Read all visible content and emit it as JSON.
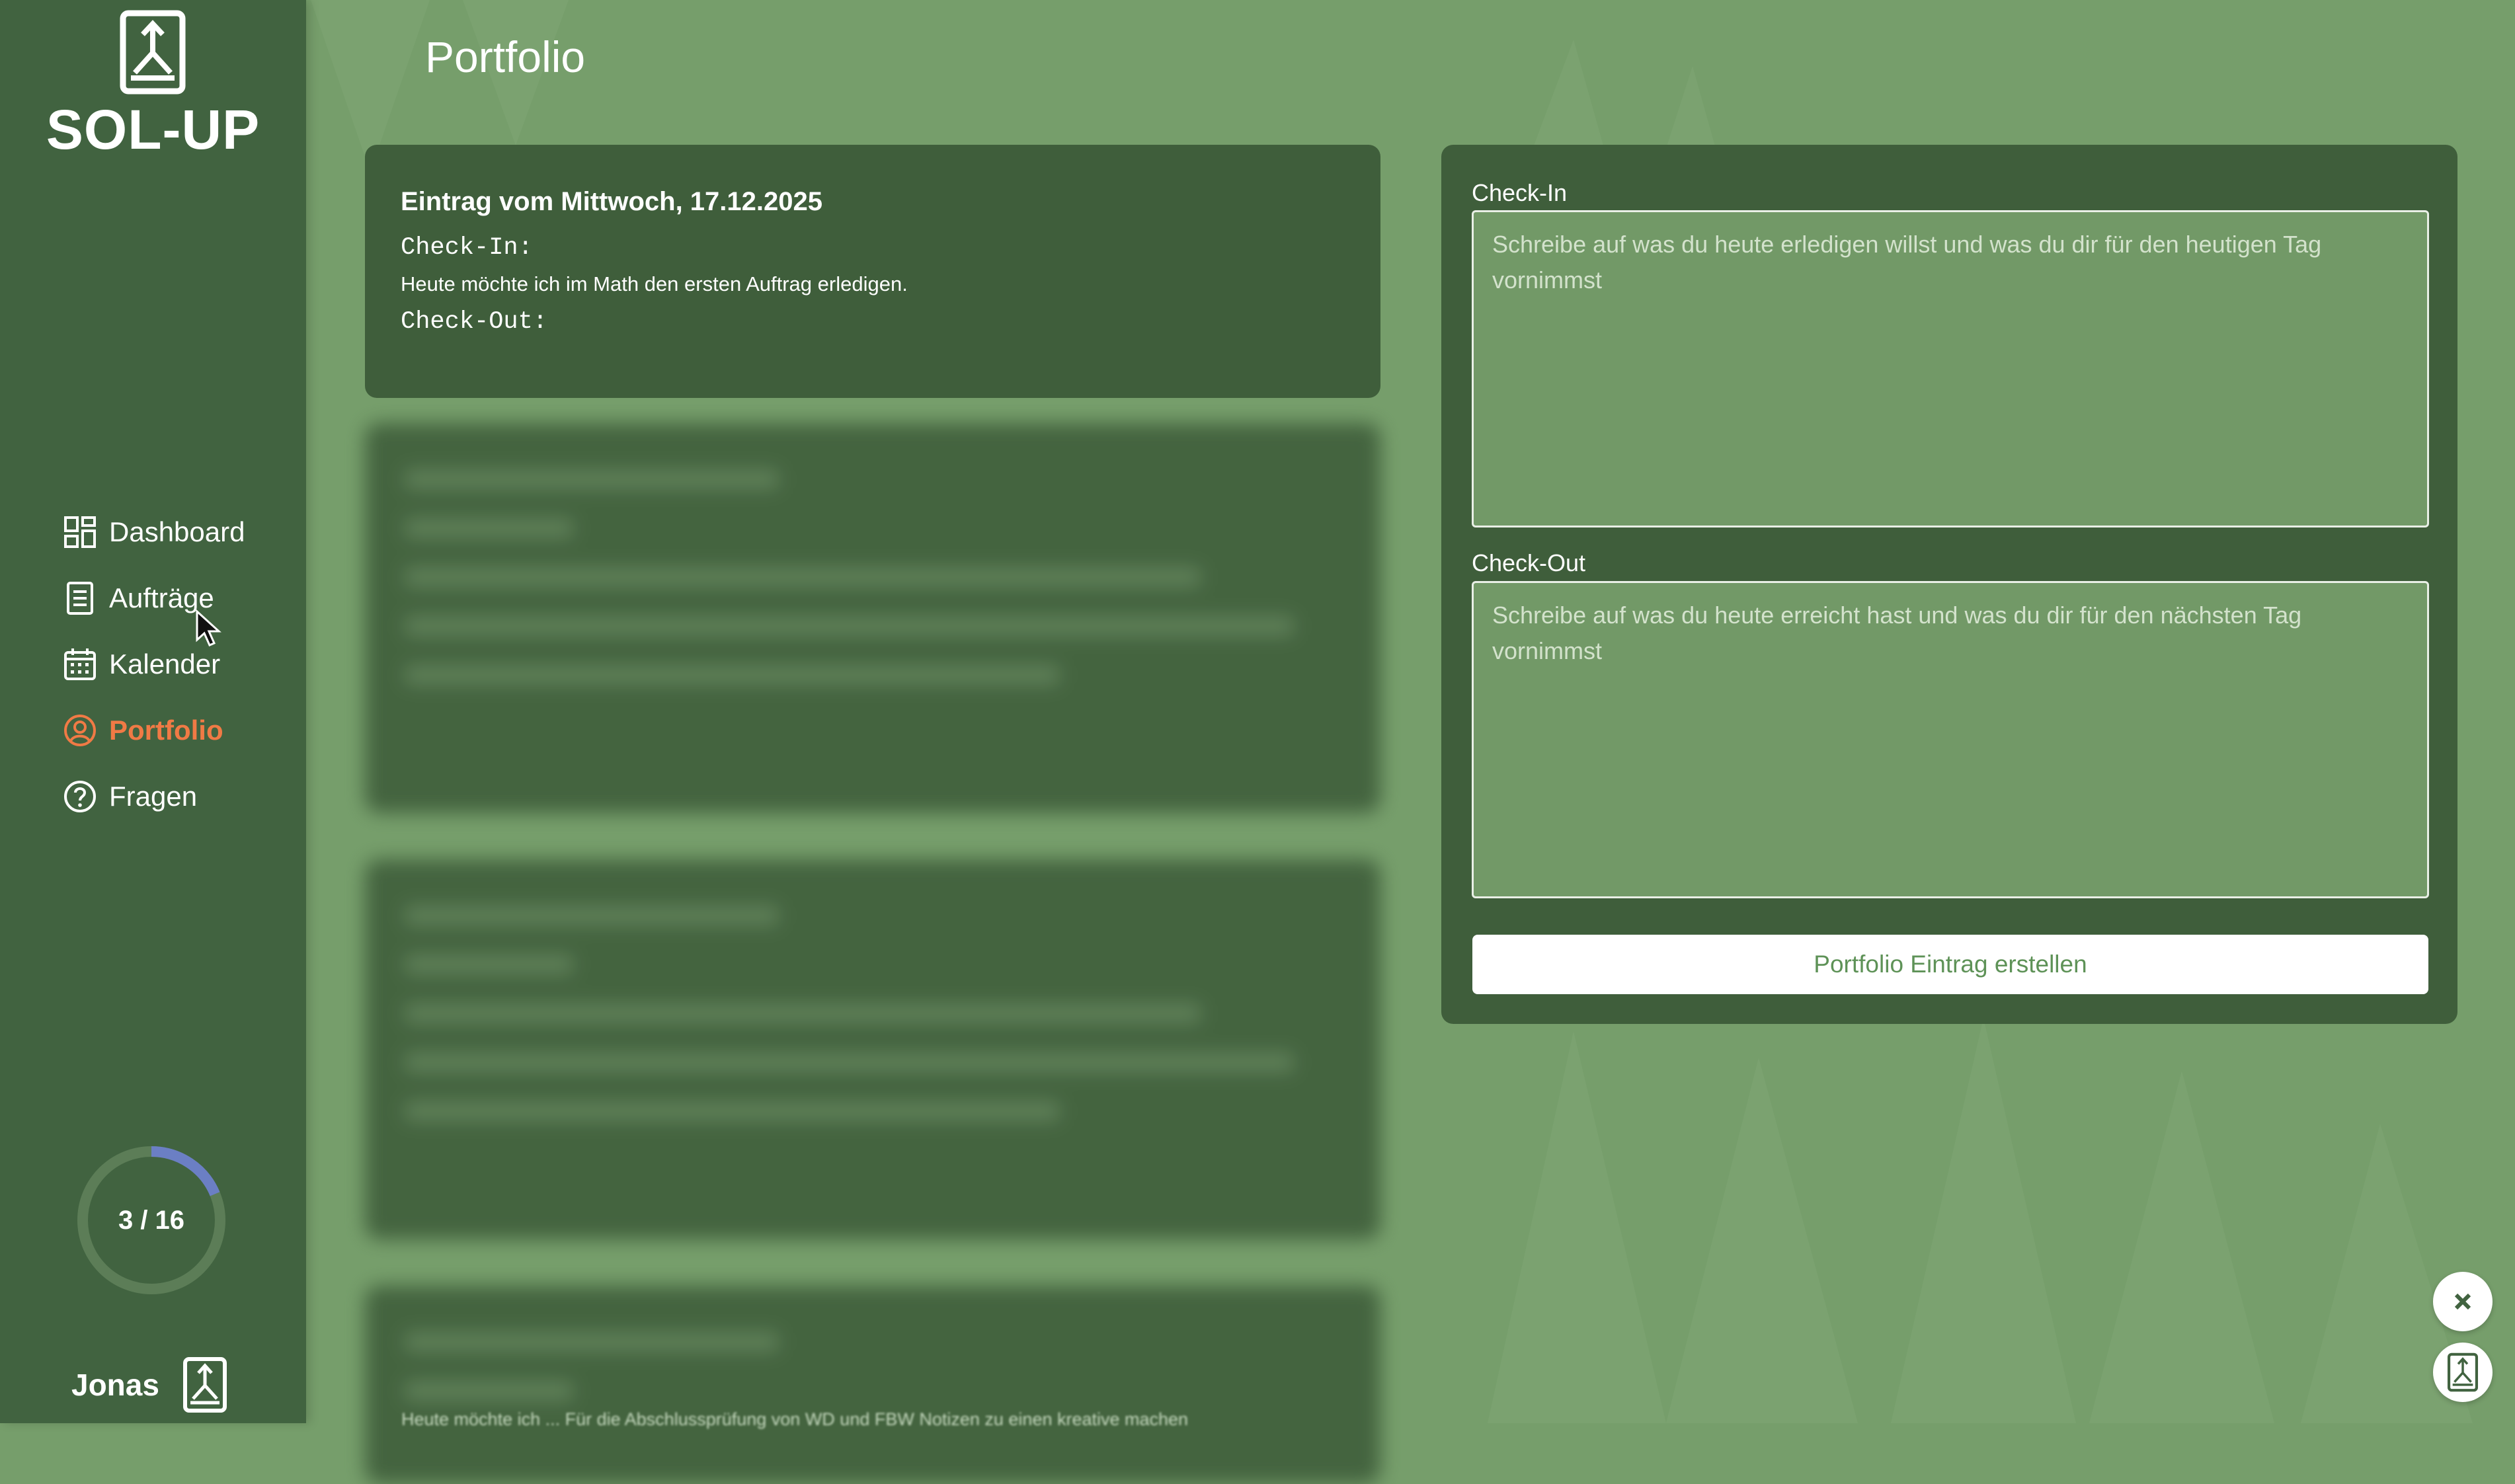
{
  "app": {
    "name": "SOL-UP"
  },
  "colors": {
    "sidebar": "#416340",
    "background": "#769e6b",
    "accent": "#f07a45",
    "card": "#3f5e3b",
    "progress": "#6b7fc4"
  },
  "sidebar": {
    "items": [
      {
        "label": "Dashboard",
        "icon": "dashboard-icon",
        "active": false
      },
      {
        "label": "Aufträge",
        "icon": "document-icon",
        "active": false
      },
      {
        "label": "Kalender",
        "icon": "calendar-icon",
        "active": false
      },
      {
        "label": "Portfolio",
        "icon": "user-circle-icon",
        "active": true
      },
      {
        "label": "Fragen",
        "icon": "question-icon",
        "active": false
      }
    ],
    "progress": {
      "text": "3 / 16",
      "done": 3,
      "total": 16
    },
    "user": {
      "name": "Jonas"
    }
  },
  "main": {
    "title": "Portfolio",
    "entry": {
      "title": "Eintrag vom Mittwoch, 17.12.2025",
      "checkin_label": "Check-In:",
      "checkin_text": "Heute möchte ich im Math den ersten Auftrag erledigen.",
      "checkout_label": "Check-Out:"
    },
    "blurred_footer": "Heute möchte ich ... Für die Abschlussprüfung von WD und FBW Notizen zu einen kreative machen"
  },
  "form": {
    "checkin_label": "Check-In",
    "checkin_placeholder": "Schreibe auf was du heute erledigen willst und was du dir für den heutigen Tag vornimmst",
    "checkout_label": "Check-Out",
    "checkout_placeholder": "Schreibe auf was du heute erreicht hast und was du dir für den nächsten Tag vornimmst",
    "submit_label": "Portfolio Eintrag erstellen"
  }
}
